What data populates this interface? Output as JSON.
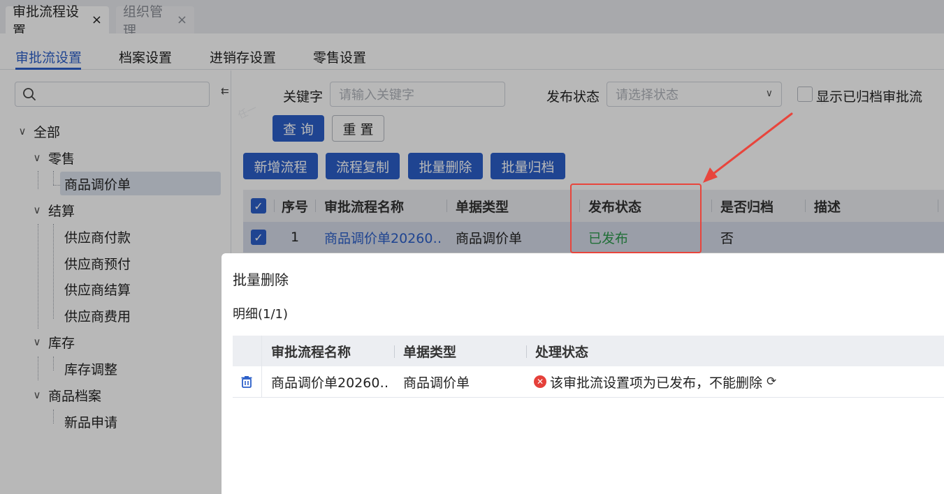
{
  "page_tabs": [
    {
      "label": "审批流程设置",
      "close": "×"
    },
    {
      "label": "组织管理",
      "close": "×"
    }
  ],
  "settings_tabs": [
    "审批流设置",
    "档案设置",
    "进销存设置",
    "零售设置"
  ],
  "tree": {
    "search_placeholder": "",
    "nodes": [
      {
        "label": "全部",
        "chev": "∨"
      },
      {
        "label": "零售",
        "chev": "∨"
      },
      {
        "label": "商品调价单"
      },
      {
        "label": "结算",
        "chev": "∨"
      },
      {
        "label": "供应商付款"
      },
      {
        "label": "供应商预付"
      },
      {
        "label": "供应商结算"
      },
      {
        "label": "供应商费用"
      },
      {
        "label": "库存",
        "chev": "∨"
      },
      {
        "label": "库存调整"
      },
      {
        "label": "商品档案",
        "chev": "∨"
      },
      {
        "label": "新品申请"
      }
    ]
  },
  "filters": {
    "keyword_label": "关键字",
    "keyword_placeholder": "请输入关键字",
    "status_label": "发布状态",
    "status_placeholder": "请选择状态",
    "show_archived_label": "显示已归档审批流",
    "query_label": "查 询",
    "reset_label": "重 置"
  },
  "actions": [
    "新增流程",
    "流程复制",
    "批量删除",
    "批量归档"
  ],
  "table": {
    "columns": [
      "序号",
      "审批流程名称",
      "单据类型",
      "发布状态",
      "是否归档",
      "描述"
    ],
    "rows": [
      {
        "index": "1",
        "name": "商品调价单20260…",
        "doc_type": "商品调价单",
        "status": "已发布",
        "archived": "否",
        "desc": ""
      }
    ]
  },
  "dialog": {
    "title": "批量删除",
    "subtitle": "明细(1/1)",
    "columns": [
      "审批流程名称",
      "单据类型",
      "处理状态"
    ],
    "rows": [
      {
        "name": "商品调价单20260…",
        "doc_type": "商品调价单",
        "result": "该审批流设置项为已发布，不能删除"
      }
    ]
  },
  "colors": {
    "accent": "#2b5fc9",
    "published": "#2e9a4e",
    "error": "#e5403a",
    "annotation": "#e8453c"
  }
}
